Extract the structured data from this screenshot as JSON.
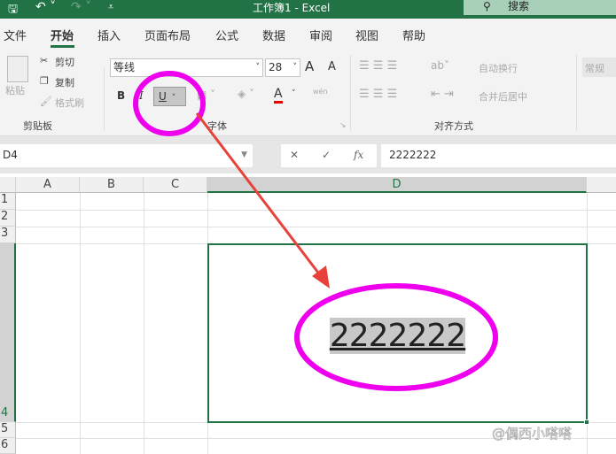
{
  "title": "工作簿1  -  Excel",
  "search": "搜索",
  "tabs": [
    "文件",
    "开始",
    "插入",
    "页面布局",
    "公式",
    "数据",
    "审阅",
    "视图",
    "帮助"
  ],
  "clipboard": {
    "paste": "粘贴",
    "cut": "剪切",
    "copy": "复制",
    "format_painter": "格式刷",
    "group": "剪贴板"
  },
  "font": {
    "name": "等线",
    "size": "28",
    "bold": "B",
    "italic": "I",
    "underline": "U",
    "font_color": "A",
    "group": "字体",
    "grow": "A",
    "shrink": "A",
    "phonetic": "wén"
  },
  "alignment": {
    "wrap": "自动换行",
    "merge": "合并后居中",
    "group": "对齐方式"
  },
  "number": {
    "format": "常规"
  },
  "formula_bar": {
    "name_box": "D4",
    "cancel": "✕",
    "enter": "✓",
    "fx": "fx",
    "value": "2222222"
  },
  "columns": [
    "A",
    "B",
    "C",
    "D"
  ],
  "rows": [
    "1",
    "2",
    "3",
    "4",
    "5",
    "6"
  ],
  "cell_D4": "2222222",
  "watermark": "@偶西小嗒嗒",
  "colors": {
    "excel_green": "#217346",
    "annotation": "#ee00ee",
    "arrow": "#e8413a"
  }
}
